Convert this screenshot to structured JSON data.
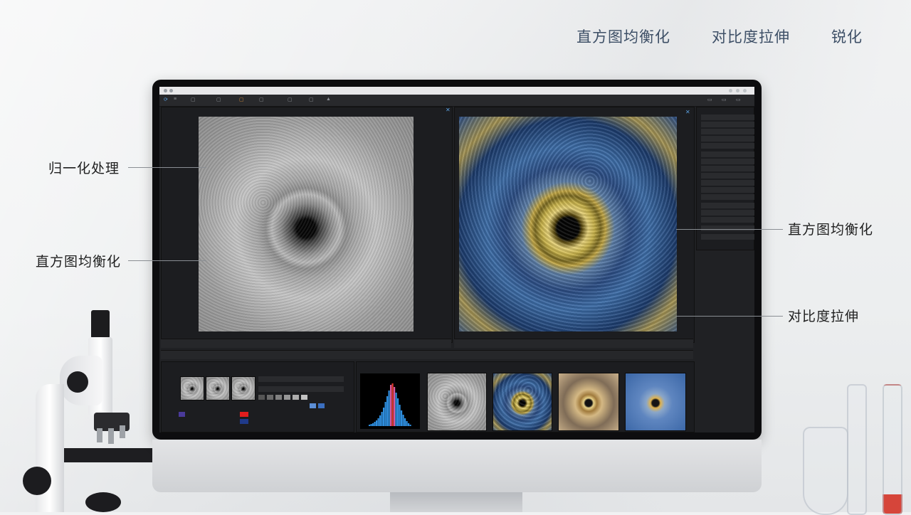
{
  "nav": {
    "items": [
      "直方图均衡化",
      "对比度拉伸",
      "锐化"
    ]
  },
  "callouts": {
    "left_top": "归一化处理",
    "left_bottom": "直方图均衡化",
    "right_top": "直方图均衡化",
    "right_bottom": "对比度拉伸"
  },
  "colors": {
    "accent_blue": "#5aa0e0",
    "nav_text": "#3d4f66",
    "screen_bg": "#202124"
  },
  "histogram": {
    "bins": [
      2,
      3,
      4,
      6,
      8,
      11,
      15,
      20,
      26,
      34,
      42,
      50,
      58,
      60,
      55,
      47,
      39,
      30,
      22,
      16,
      11,
      7,
      4,
      2
    ]
  }
}
